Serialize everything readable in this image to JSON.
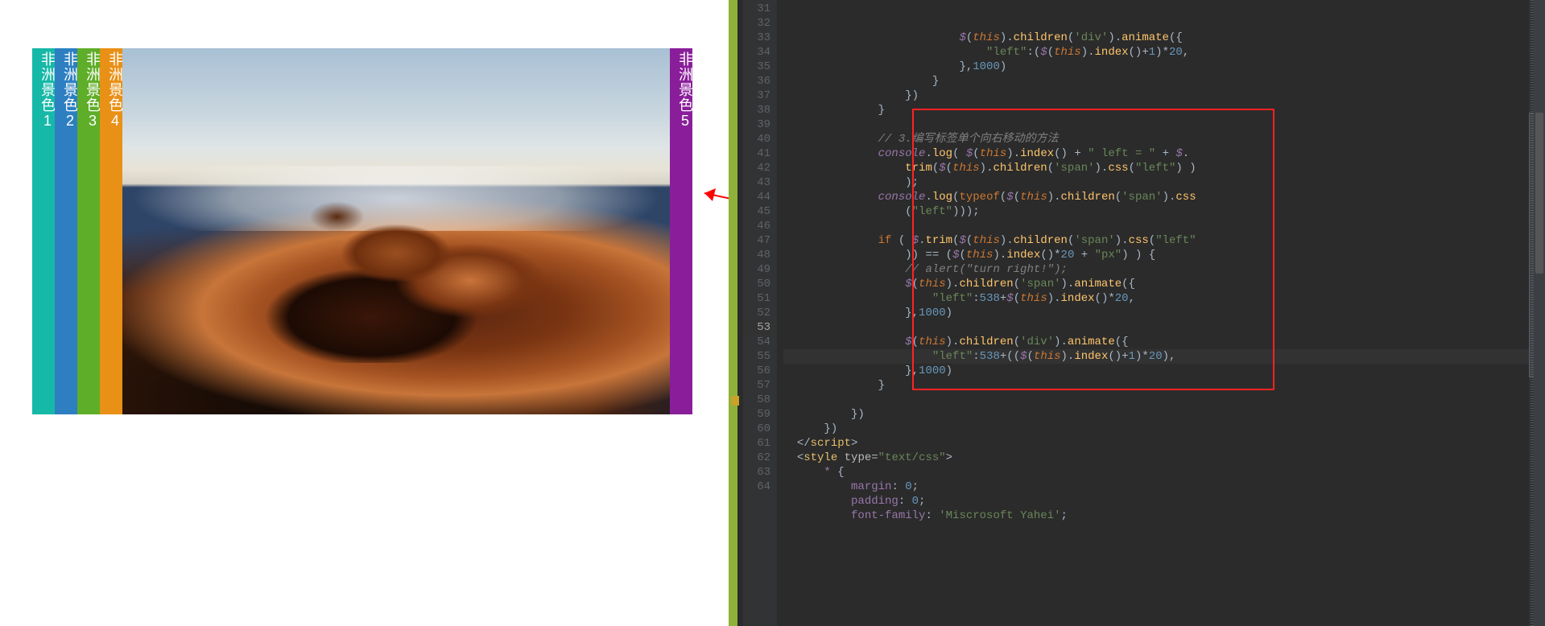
{
  "accordion": {
    "labels": [
      "非洲景色1",
      "非洲景色2",
      "非洲景色3",
      "非洲景色4",
      "非洲景色5"
    ],
    "colors": [
      "#16b8a8",
      "#2d7fc2",
      "#5fae29",
      "#e99016",
      "#8a1e9a"
    ],
    "photo_alt": "desert-dunes-fog"
  },
  "editor": {
    "first_line": 31,
    "current_line": 53,
    "lines": [
      {
        "n": 31,
        "i": 13,
        "seg": [
          [
            "gl",
            "$"
          ],
          [
            "pn",
            "("
          ],
          [
            "th",
            "this"
          ],
          [
            "pn",
            ")."
          ],
          [
            "fn",
            "children"
          ],
          [
            "pn",
            "("
          ],
          [
            "st",
            "'div'"
          ],
          [
            "pn",
            ")."
          ],
          [
            "fn",
            "animate"
          ],
          [
            "pn",
            "({"
          ]
        ]
      },
      {
        "n": 32,
        "i": 15,
        "seg": [
          [
            "st",
            "\"left\""
          ],
          [
            "pn",
            ":("
          ],
          [
            "gl",
            "$"
          ],
          [
            "pn",
            "("
          ],
          [
            "th",
            "this"
          ],
          [
            "pn",
            ")."
          ],
          [
            "fn",
            "index"
          ],
          [
            "pn",
            "()"
          ],
          [
            "op",
            "+"
          ],
          [
            "nu",
            "1"
          ],
          [
            "pn",
            ")"
          ],
          [
            "op",
            "*"
          ],
          [
            "nu",
            "20"
          ],
          [
            "pn",
            ","
          ]
        ]
      },
      {
        "n": 33,
        "i": 13,
        "seg": [
          [
            "pn",
            "},"
          ],
          [
            "nu",
            "1000"
          ],
          [
            "pn",
            ")"
          ]
        ]
      },
      {
        "n": 34,
        "i": 11,
        "seg": [
          [
            "pn",
            "}"
          ]
        ]
      },
      {
        "n": 35,
        "i": 9,
        "seg": [
          [
            "pn",
            "})"
          ]
        ]
      },
      {
        "n": 36,
        "i": 7,
        "seg": [
          [
            "pn",
            "}"
          ]
        ]
      },
      {
        "n": 37,
        "i": 0,
        "seg": []
      },
      {
        "n": 38,
        "i": 7,
        "seg": [
          [
            "cm",
            "// 3.编写标签单个向右移动的方法"
          ]
        ]
      },
      {
        "n": 39,
        "i": 7,
        "seg": [
          [
            "gl",
            "console"
          ],
          [
            "pn",
            "."
          ],
          [
            "fn",
            "log"
          ],
          [
            "pn",
            "( "
          ],
          [
            "gl",
            "$"
          ],
          [
            "pn",
            "("
          ],
          [
            "th",
            "this"
          ],
          [
            "pn",
            ")."
          ],
          [
            "fn",
            "index"
          ],
          [
            "pn",
            "() "
          ],
          [
            "op",
            "+"
          ],
          [
            "pn",
            " "
          ],
          [
            "st",
            "\" left = \""
          ],
          [
            "pn",
            " "
          ],
          [
            "op",
            "+"
          ],
          [
            "pn",
            " "
          ],
          [
            "gl",
            "$"
          ],
          [
            "pn",
            "."
          ]
        ]
      },
      {
        "n": 40,
        "i": 9,
        "seg": [
          [
            "fn",
            "trim"
          ],
          [
            "pn",
            "("
          ],
          [
            "gl",
            "$"
          ],
          [
            "pn",
            "("
          ],
          [
            "th",
            "this"
          ],
          [
            "pn",
            ")."
          ],
          [
            "fn",
            "children"
          ],
          [
            "pn",
            "("
          ],
          [
            "st",
            "'span'"
          ],
          [
            "pn",
            ")."
          ],
          [
            "fn",
            "css"
          ],
          [
            "pn",
            "("
          ],
          [
            "st",
            "\"left\""
          ],
          [
            "pn",
            ") )"
          ]
        ]
      },
      {
        "n": 41,
        "i": 9,
        "seg": [
          [
            "pn",
            ");"
          ]
        ]
      },
      {
        "n": 42,
        "i": 7,
        "seg": [
          [
            "gl",
            "console"
          ],
          [
            "pn",
            "."
          ],
          [
            "fn",
            "log"
          ],
          [
            "pn",
            "("
          ],
          [
            "kw",
            "typeof"
          ],
          [
            "pn",
            "("
          ],
          [
            "gl",
            "$"
          ],
          [
            "pn",
            "("
          ],
          [
            "th",
            "this"
          ],
          [
            "pn",
            ")."
          ],
          [
            "fn",
            "children"
          ],
          [
            "pn",
            "("
          ],
          [
            "st",
            "'span'"
          ],
          [
            "pn",
            ")."
          ],
          [
            "fn",
            "css"
          ]
        ]
      },
      {
        "n": 43,
        "i": 9,
        "seg": [
          [
            "pn",
            "("
          ],
          [
            "st",
            "\"left\""
          ],
          [
            "pn",
            ")));"
          ]
        ]
      },
      {
        "n": 44,
        "i": 0,
        "seg": []
      },
      {
        "n": 45,
        "i": 7,
        "seg": [
          [
            "kw",
            "if"
          ],
          [
            "pn",
            " ( "
          ],
          [
            "gl",
            "$"
          ],
          [
            "pn",
            "."
          ],
          [
            "fn",
            "trim"
          ],
          [
            "pn",
            "("
          ],
          [
            "gl",
            "$"
          ],
          [
            "pn",
            "("
          ],
          [
            "th",
            "this"
          ],
          [
            "pn",
            ")."
          ],
          [
            "fn",
            "children"
          ],
          [
            "pn",
            "("
          ],
          [
            "st",
            "'span'"
          ],
          [
            "pn",
            ")."
          ],
          [
            "fn",
            "css"
          ],
          [
            "pn",
            "("
          ],
          [
            "st",
            "\"left\""
          ]
        ]
      },
      {
        "n": 46,
        "i": 9,
        "seg": [
          [
            "pn",
            ")) "
          ],
          [
            "op",
            "=="
          ],
          [
            "pn",
            " ("
          ],
          [
            "gl",
            "$"
          ],
          [
            "pn",
            "("
          ],
          [
            "th",
            "this"
          ],
          [
            "pn",
            ")."
          ],
          [
            "fn",
            "index"
          ],
          [
            "pn",
            "()"
          ],
          [
            "op",
            "*"
          ],
          [
            "nu",
            "20"
          ],
          [
            "pn",
            " "
          ],
          [
            "op",
            "+"
          ],
          [
            "pn",
            " "
          ],
          [
            "st",
            "\"px\""
          ],
          [
            "pn",
            ") ) {"
          ]
        ]
      },
      {
        "n": 47,
        "i": 9,
        "seg": [
          [
            "cm",
            "// alert(\"turn right!\");"
          ]
        ]
      },
      {
        "n": 48,
        "i": 9,
        "seg": [
          [
            "gl",
            "$"
          ],
          [
            "pn",
            "("
          ],
          [
            "th",
            "this"
          ],
          [
            "pn",
            ")."
          ],
          [
            "fn",
            "children"
          ],
          [
            "pn",
            "("
          ],
          [
            "st",
            "'span'"
          ],
          [
            "pn",
            ")."
          ],
          [
            "fn",
            "animate"
          ],
          [
            "pn",
            "({"
          ]
        ]
      },
      {
        "n": 49,
        "i": 11,
        "seg": [
          [
            "st",
            "\"left\""
          ],
          [
            "pn",
            ":"
          ],
          [
            "nu",
            "538"
          ],
          [
            "op",
            "+"
          ],
          [
            "gl",
            "$"
          ],
          [
            "pn",
            "("
          ],
          [
            "th",
            "this"
          ],
          [
            "pn",
            ")."
          ],
          [
            "fn",
            "index"
          ],
          [
            "pn",
            "()"
          ],
          [
            "op",
            "*"
          ],
          [
            "nu",
            "20"
          ],
          [
            "pn",
            ","
          ]
        ]
      },
      {
        "n": 50,
        "i": 9,
        "seg": [
          [
            "pn",
            "},"
          ],
          [
            "nu",
            "1000"
          ],
          [
            "pn",
            ")"
          ]
        ]
      },
      {
        "n": 51,
        "i": 0,
        "seg": []
      },
      {
        "n": 52,
        "i": 9,
        "seg": [
          [
            "gl",
            "$"
          ],
          [
            "pn",
            "("
          ],
          [
            "th",
            "this"
          ],
          [
            "pn",
            ")."
          ],
          [
            "fn",
            "children"
          ],
          [
            "pn",
            "("
          ],
          [
            "st",
            "'div'"
          ],
          [
            "pn",
            ")."
          ],
          [
            "fn",
            "animate"
          ],
          [
            "pn",
            "({"
          ]
        ]
      },
      {
        "n": 53,
        "i": 11,
        "seg": [
          [
            "st",
            "\"left\""
          ],
          [
            "pn",
            ":"
          ],
          [
            "nu",
            "538"
          ],
          [
            "op",
            "+"
          ],
          [
            "pn",
            "(("
          ],
          [
            "gl",
            "$"
          ],
          [
            "pn",
            "("
          ],
          [
            "th",
            "this"
          ],
          [
            "pn",
            ")."
          ],
          [
            "fn",
            "index"
          ],
          [
            "pn",
            "()"
          ],
          [
            "op",
            "+"
          ],
          [
            "nu",
            "1"
          ],
          [
            "pn",
            ")"
          ],
          [
            "op",
            "*"
          ],
          [
            "nu",
            "20"
          ],
          [
            "pn",
            "),"
          ]
        ]
      },
      {
        "n": 54,
        "i": 9,
        "seg": [
          [
            "pn",
            "},"
          ],
          [
            "nu",
            "1000"
          ],
          [
            "pn",
            ")"
          ]
        ]
      },
      {
        "n": 55,
        "i": 7,
        "seg": [
          [
            "pn",
            "}"
          ]
        ]
      },
      {
        "n": 56,
        "i": 0,
        "seg": []
      },
      {
        "n": 57,
        "i": 5,
        "seg": [
          [
            "pn",
            "})"
          ]
        ]
      },
      {
        "n": 58,
        "i": 3,
        "seg": [
          [
            "pn",
            "})"
          ]
        ]
      },
      {
        "n": 59,
        "i": 1,
        "seg": [
          [
            "pn",
            "</"
          ],
          [
            "tg",
            "script"
          ],
          [
            "pn",
            ">"
          ]
        ]
      },
      {
        "n": 60,
        "i": 1,
        "seg": [
          [
            "pn",
            "<"
          ],
          [
            "tg",
            "style"
          ],
          [
            "pn",
            " "
          ],
          [
            "at",
            "type"
          ],
          [
            "pn",
            "="
          ],
          [
            "st",
            "\"text/css\""
          ],
          [
            "pn",
            ">"
          ]
        ]
      },
      {
        "n": 61,
        "i": 3,
        "seg": [
          [
            "pr",
            "*"
          ],
          [
            "pn",
            " {"
          ]
        ]
      },
      {
        "n": 62,
        "i": 5,
        "seg": [
          [
            "pr",
            "margin"
          ],
          [
            "pn",
            ": "
          ],
          [
            "nu",
            "0"
          ],
          [
            "pn",
            ";"
          ]
        ]
      },
      {
        "n": 63,
        "i": 5,
        "seg": [
          [
            "pr",
            "padding"
          ],
          [
            "pn",
            ": "
          ],
          [
            "nu",
            "0"
          ],
          [
            "pn",
            ";"
          ]
        ]
      },
      {
        "n": 64,
        "i": 5,
        "seg": [
          [
            "pr",
            "font-family"
          ],
          [
            "pn",
            ": "
          ],
          [
            "st",
            "'Miscrosoft Yahei'"
          ],
          [
            "pn",
            ";"
          ]
        ]
      }
    ]
  }
}
